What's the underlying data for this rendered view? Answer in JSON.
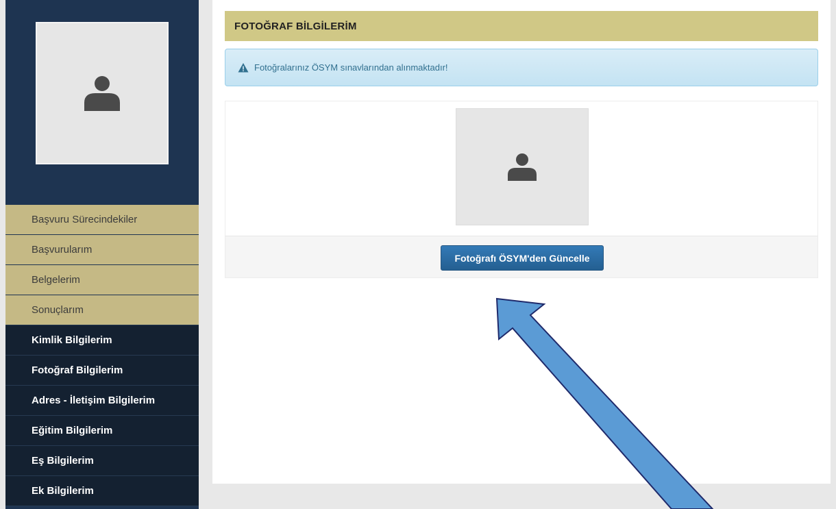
{
  "sidebar": {
    "menu_gold": [
      {
        "label": "Başvuru Sürecindekiler"
      },
      {
        "label": "Başvurularım"
      },
      {
        "label": "Belgelerim"
      },
      {
        "label": "Sonuçlarım"
      }
    ],
    "menu_dark": [
      {
        "label": "Kimlik Bilgilerim"
      },
      {
        "label": "Fotoğraf Bilgilerim"
      },
      {
        "label": "Adres - İletişim Bilgilerim"
      },
      {
        "label": "Eğitim Bilgilerim"
      },
      {
        "label": "Eş Bilgilerim"
      },
      {
        "label": "Ek Bilgilerim"
      }
    ],
    "avatar_icon": "user-icon"
  },
  "main": {
    "section_title": "FOTOĞRAF BİLGİLERİM",
    "alert_text": "Fotoğralarınız ÖSYM sınavlarından alınmaktadır!",
    "alert_icon": "warning-icon",
    "photo_icon": "user-icon",
    "update_button_label": "Fotoğrafı ÖSYM'den Güncelle"
  },
  "colors": {
    "sidebar_bg": "#1e3451",
    "menu_gold": "#c5b985",
    "menu_dark": "#142131",
    "header_gold": "#d0c886",
    "alert_bg": "#d9edf7",
    "alert_text": "#31708f",
    "button": "#337ab7",
    "arrow": "#5b9bd5"
  }
}
